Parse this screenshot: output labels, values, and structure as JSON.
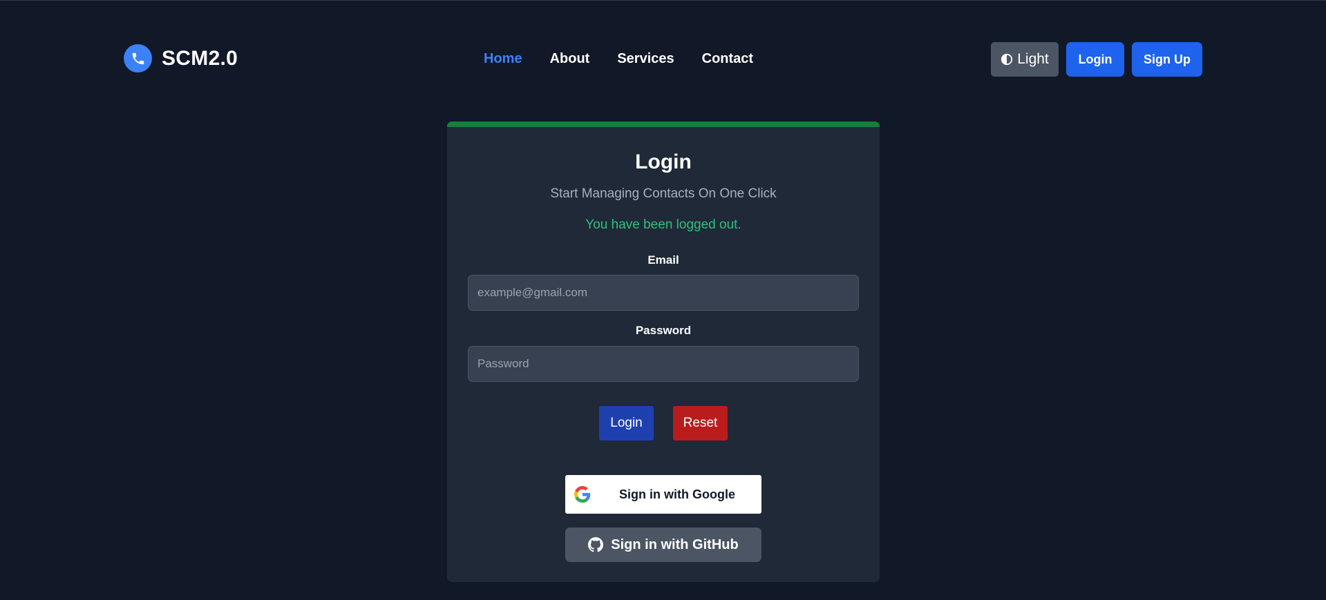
{
  "brand": {
    "name": "SCM2.0",
    "icon": "phone-icon"
  },
  "nav": {
    "items": [
      {
        "label": "Home",
        "active": true
      },
      {
        "label": "About",
        "active": false
      },
      {
        "label": "Services",
        "active": false
      },
      {
        "label": "Contact",
        "active": false
      }
    ]
  },
  "header_actions": {
    "theme_label": "Light",
    "theme_icon": "contrast-icon",
    "login_label": "Login",
    "signup_label": "Sign Up"
  },
  "login_card": {
    "title": "Login",
    "subtitle": "Start Managing Contacts On One Click",
    "message": "You have been logged out.",
    "email": {
      "label": "Email",
      "placeholder": "example@gmail.com",
      "value": ""
    },
    "password": {
      "label": "Password",
      "placeholder": "Password",
      "value": ""
    },
    "submit_label": "Login",
    "reset_label": "Reset",
    "google_label": "Sign in with Google",
    "github_label": "Sign in with GitHub"
  },
  "colors": {
    "background": "#111827",
    "card": "#1f2937",
    "accent_bar": "#15803d",
    "primary": "#1d63ed",
    "nav_active": "#3b82f6",
    "success_text": "#34c07a",
    "danger": "#b91c1c"
  }
}
